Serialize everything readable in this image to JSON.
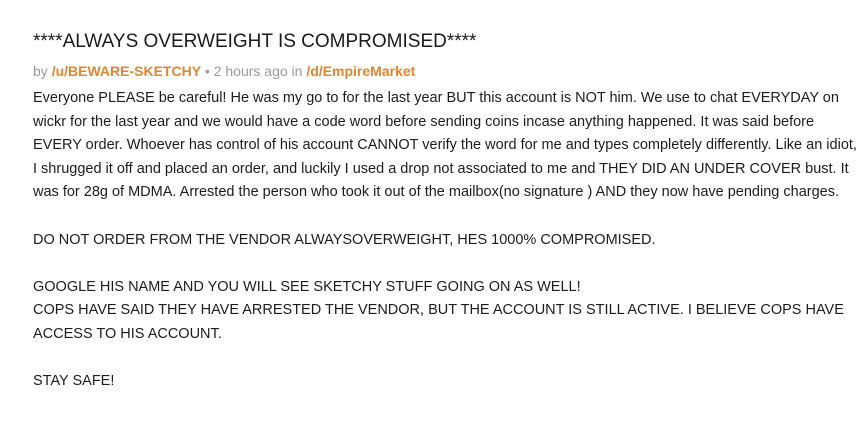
{
  "post": {
    "title": "****ALWAYS OVERWEIGHT IS COMPROMISED****",
    "meta": {
      "by_prefix": "by ",
      "author": "/u/BEWARE-SKETCHY",
      "separator": " • ",
      "time": "2 hours ago",
      "in_text": " in ",
      "community": "/d/EmpireMarket"
    },
    "body": {
      "p1": "Everyone PLEASE be careful! He was my go to for the last year BUT this account is NOT him. We use to chat EVERYDAY on wickr for the last year and we would have a code word before sending coins incase anything happened. It was said before EVERY order. Whoever has control of his account CANNOT verify the word for me and types completely differently. Like an idiot, I shrugged it off and placed an order, and luckily I used a drop not associated to me and THEY DID AN UNDER COVER bust. It was for 28g of MDMA. Arrested the person who took it out of the mailbox(no signature ) AND they now have pending charges.",
      "p2": "DO NOT ORDER FROM THE VENDOR ALWAYSOVERWEIGHT, HES 1000% COMPROMISED.",
      "p3_line1": "GOOGLE HIS NAME AND YOU WILL SEE SKETCHY STUFF GOING ON AS WELL!",
      "p3_line2": "COPS HAVE SAID THEY HAVE ARRESTED THE VENDOR, BUT THE ACCOUNT IS STILL ACTIVE. I BELIEVE COPS HAVE ACCESS TO HIS ACCOUNT.",
      "p4": "STAY SAFE!"
    },
    "colors": {
      "link": "#e0862f",
      "meta_text": "#9a9a9a",
      "body_text": "#1c1c1c",
      "background": "#ffffff"
    }
  }
}
